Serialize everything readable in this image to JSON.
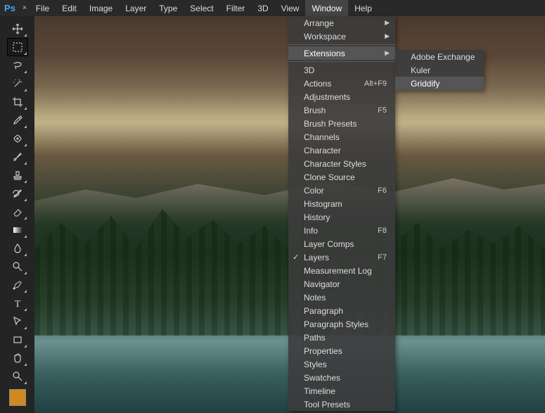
{
  "app": {
    "logo": "Ps",
    "doc_close": "×"
  },
  "menu": {
    "items": [
      "File",
      "Edit",
      "Image",
      "Layer",
      "Type",
      "Select",
      "Filter",
      "3D",
      "View",
      "Window",
      "Help"
    ],
    "active_index": 9
  },
  "tools": [
    {
      "name": "move-tool",
      "icon": "move"
    },
    {
      "name": "marquee-tool",
      "icon": "marquee",
      "selected": true
    },
    {
      "name": "lasso-tool",
      "icon": "lasso"
    },
    {
      "name": "magic-wand-tool",
      "icon": "wand"
    },
    {
      "name": "crop-tool",
      "icon": "crop"
    },
    {
      "name": "eyedropper-tool",
      "icon": "eyedropper"
    },
    {
      "name": "healing-brush-tool",
      "icon": "patch"
    },
    {
      "name": "brush-tool",
      "icon": "brush"
    },
    {
      "name": "clone-stamp-tool",
      "icon": "stamp"
    },
    {
      "name": "history-brush-tool",
      "icon": "history"
    },
    {
      "name": "eraser-tool",
      "icon": "eraser"
    },
    {
      "name": "gradient-tool",
      "icon": "gradient"
    },
    {
      "name": "blur-tool",
      "icon": "blur"
    },
    {
      "name": "dodge-tool",
      "icon": "dodge"
    },
    {
      "name": "pen-tool",
      "icon": "pen"
    },
    {
      "name": "type-tool",
      "icon": "type"
    },
    {
      "name": "path-selection-tool",
      "icon": "arrow"
    },
    {
      "name": "rectangle-tool",
      "icon": "rect"
    },
    {
      "name": "hand-tool",
      "icon": "hand"
    },
    {
      "name": "zoom-tool",
      "icon": "zoom"
    }
  ],
  "swatch_fg": "#d08820",
  "window_menu": {
    "top": [
      {
        "label": "Arrange",
        "submenu": true
      },
      {
        "label": "Workspace",
        "submenu": true
      }
    ],
    "extensions": {
      "label": "Extensions",
      "submenu": true,
      "highlight": true
    },
    "panels": [
      {
        "label": "3D"
      },
      {
        "label": "Actions",
        "shortcut": "Alt+F9"
      },
      {
        "label": "Adjustments"
      },
      {
        "label": "Brush",
        "shortcut": "F5"
      },
      {
        "label": "Brush Presets"
      },
      {
        "label": "Channels"
      },
      {
        "label": "Character"
      },
      {
        "label": "Character Styles"
      },
      {
        "label": "Clone Source"
      },
      {
        "label": "Color",
        "shortcut": "F6"
      },
      {
        "label": "Histogram"
      },
      {
        "label": "History"
      },
      {
        "label": "Info",
        "shortcut": "F8"
      },
      {
        "label": "Layer Comps"
      },
      {
        "label": "Layers",
        "shortcut": "F7",
        "checked": true
      },
      {
        "label": "Measurement Log"
      },
      {
        "label": "Navigator"
      },
      {
        "label": "Notes"
      },
      {
        "label": "Paragraph"
      },
      {
        "label": "Paragraph Styles"
      },
      {
        "label": "Paths"
      },
      {
        "label": "Properties"
      },
      {
        "label": "Styles"
      },
      {
        "label": "Swatches"
      },
      {
        "label": "Timeline"
      },
      {
        "label": "Tool Presets"
      }
    ]
  },
  "extensions_menu": [
    {
      "label": "Adobe Exchange"
    },
    {
      "label": "Kuler"
    },
    {
      "label": "Griddify",
      "highlight": true
    }
  ]
}
